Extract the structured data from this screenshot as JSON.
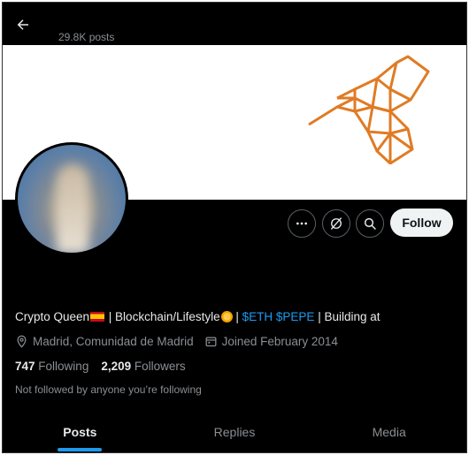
{
  "header": {
    "back_icon": "arrow-left-icon",
    "post_count": "29.8K posts"
  },
  "banner": {
    "logo": "geometric-orange-hummingbird",
    "logo_color": "#e07b24",
    "background": "#ffffff"
  },
  "profile": {
    "avatar_alt": "profile-avatar",
    "bio": {
      "part1": "Crypto Queen",
      "part2": " | Blockchain/Lifestyle",
      "part3": " | ",
      "link": "$ETH $PEPE",
      "part4": " | Building at"
    },
    "location": "Madrid, Comunidad de Madrid",
    "joined": "Joined February 2014",
    "following_count": "747",
    "following_label": "Following",
    "followers_count": "2,209",
    "followers_label": "Followers",
    "not_followed": "Not followed by anyone you’re following"
  },
  "actions": {
    "more_icon": "more-horizontal-icon",
    "grok_icon": "grok-icon",
    "search_icon": "search-icon",
    "follow_label": "Follow"
  },
  "tabs": [
    {
      "label": "Posts",
      "active": true
    },
    {
      "label": "Replies",
      "active": false
    },
    {
      "label": "Media",
      "active": false
    }
  ],
  "colors": {
    "background": "#000000",
    "text": "#e7e9ea",
    "muted": "#8a8f94",
    "link": "#1d9bf0",
    "follow_button": "#eff3f4"
  }
}
